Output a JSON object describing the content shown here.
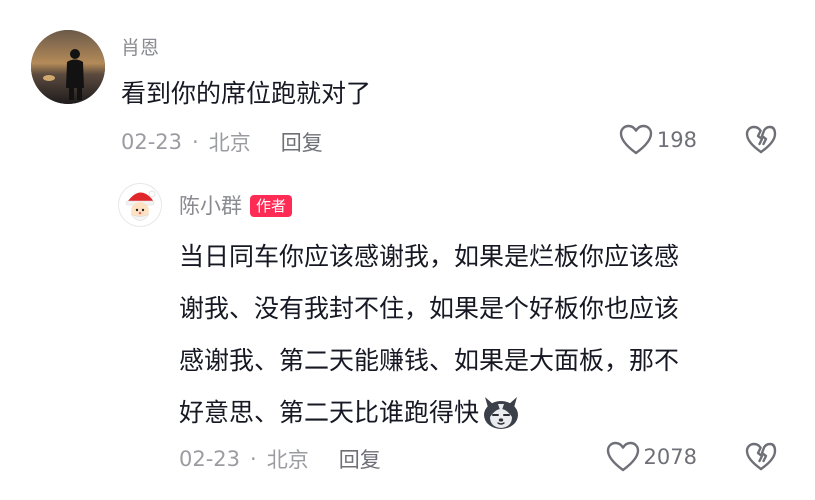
{
  "comments": [
    {
      "author": "肖恩",
      "content": "看到你的席位跑就对了",
      "date": "02-23",
      "separator": "·",
      "location": "北京",
      "reply_label": "回复",
      "likes": "198",
      "avatar_icon": "person-silhouette-sunset-avatar"
    },
    {
      "author": "陈小群",
      "badge": "作者",
      "content_lines": [
        "当日同车你应该感谢我，如果是烂板你应该感",
        "谢我、没有我封不住，如果是个好板你也应该",
        "感谢我、第二天能赚钱、如果是大面板，那不",
        "好意思、第二天比谁跑得快"
      ],
      "emoji_icon": "husky-dog-emoji",
      "date": "02-23",
      "separator": "·",
      "location": "北京",
      "reply_label": "回复",
      "likes": "2078",
      "avatar_icon": "santa-cartoon-avatar"
    }
  ],
  "colors": {
    "text": "#161823",
    "secondary": "#9b9ca2",
    "author_badge": "#fe2c55"
  }
}
